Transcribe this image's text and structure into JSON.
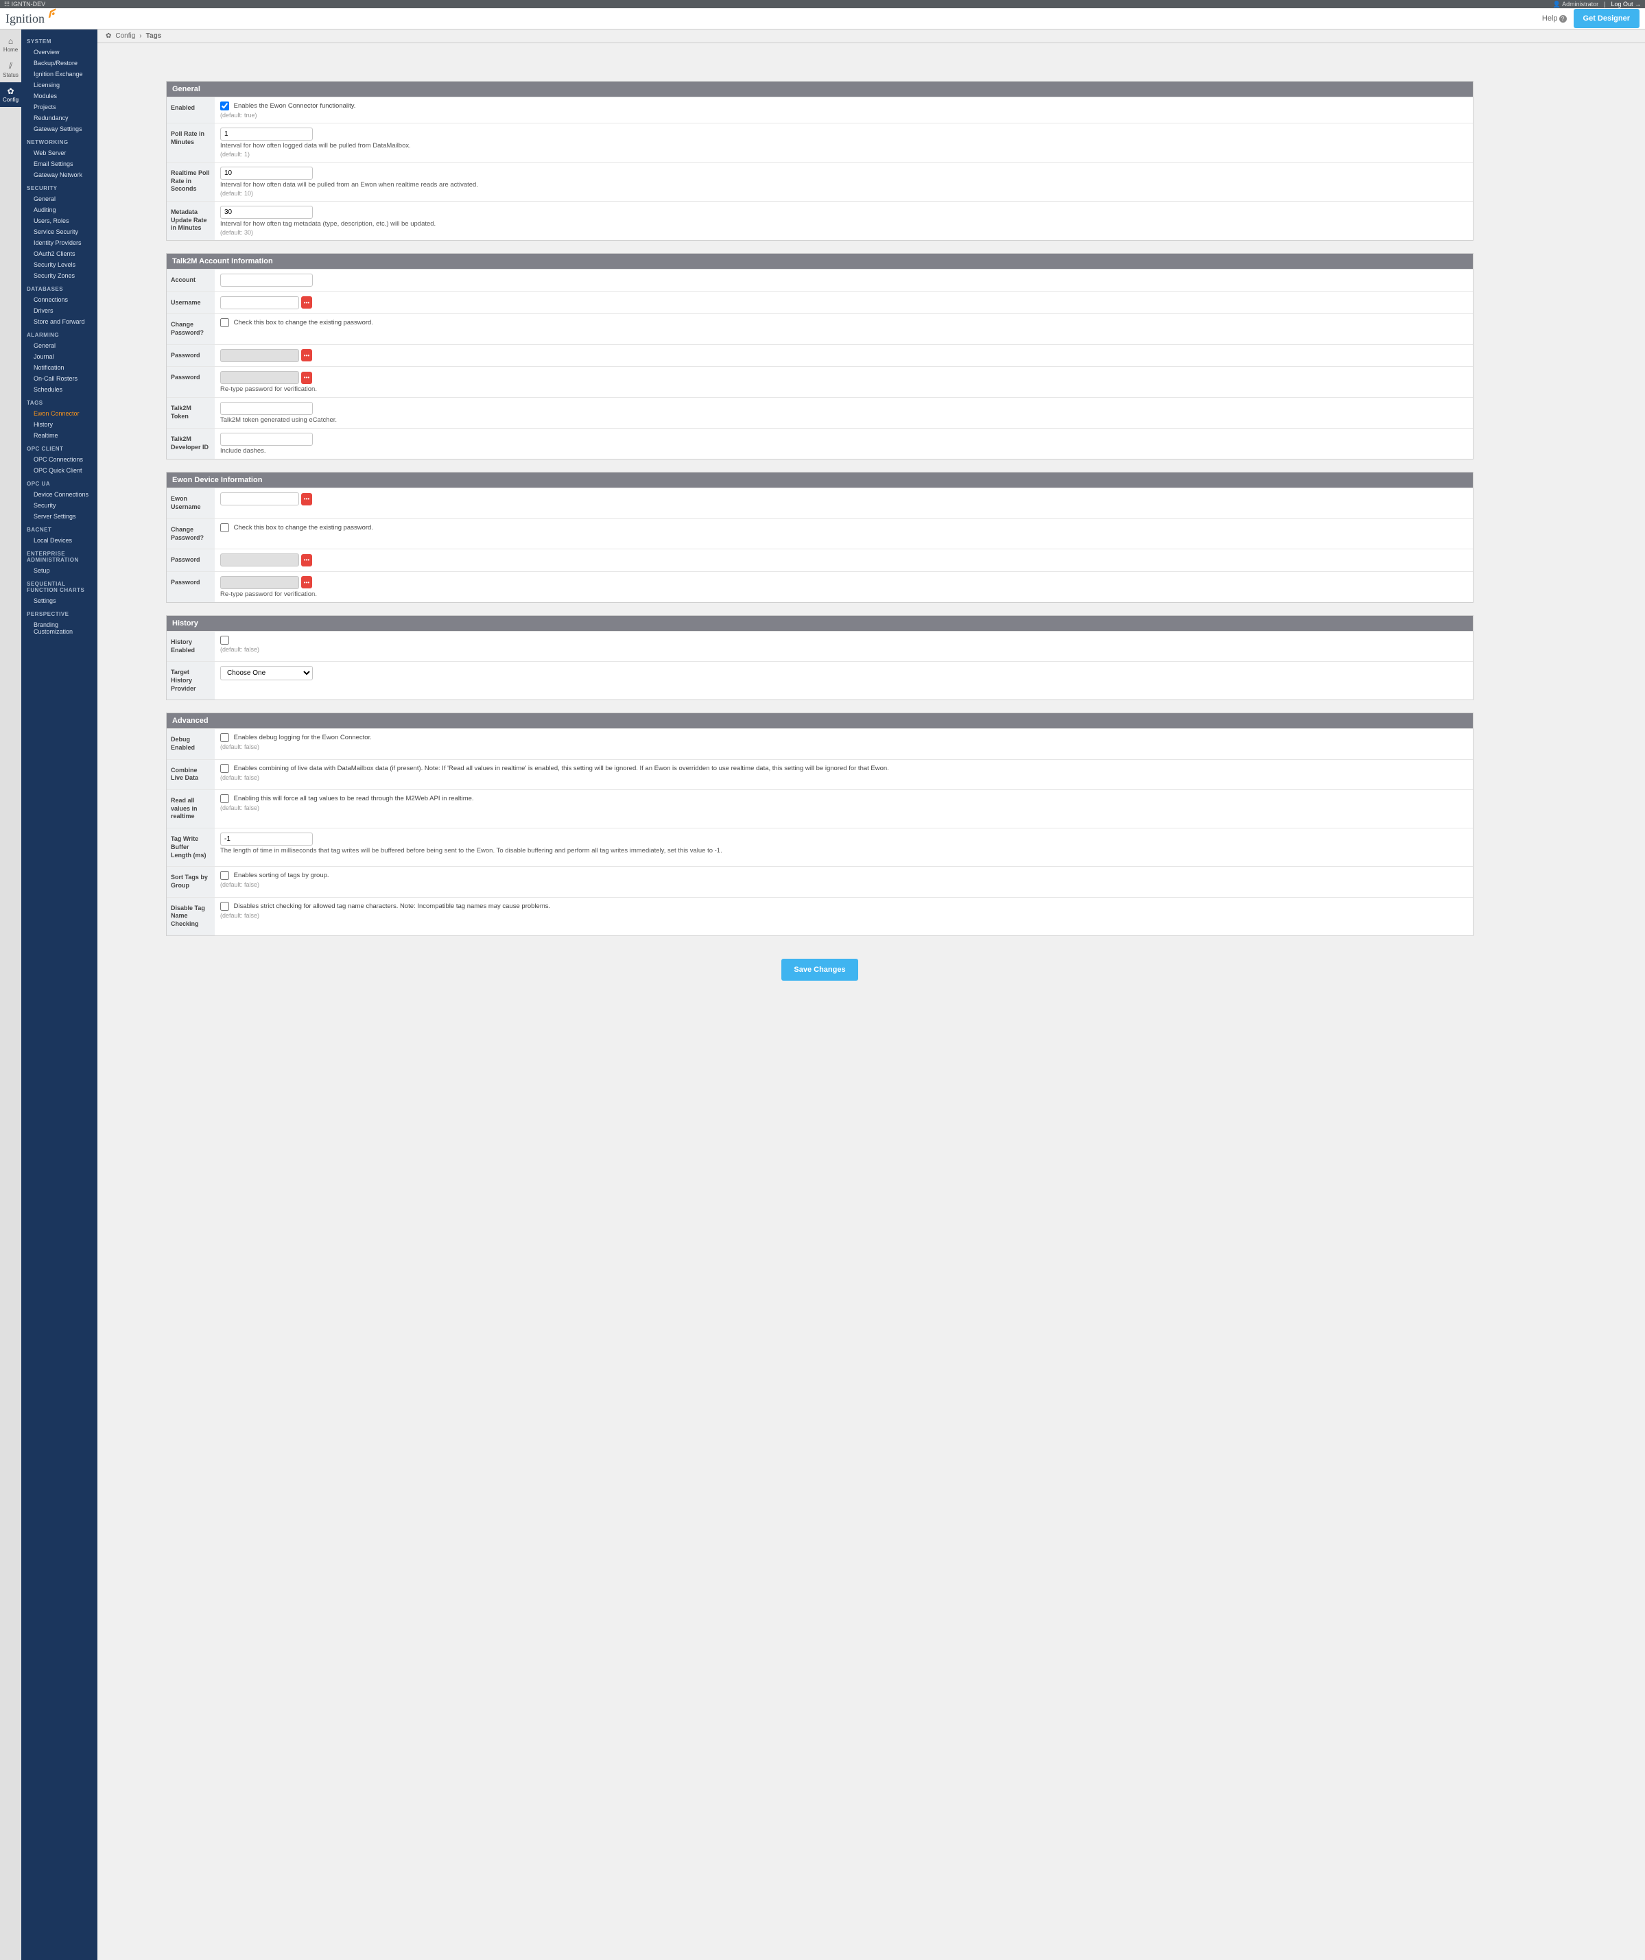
{
  "trialBar": {
    "left": "☷ IGNTN-DEV",
    "admin": "Administrator",
    "logout": "Log Out"
  },
  "header": {
    "logo": "Ignition",
    "help": "Help",
    "designer": "Get Designer"
  },
  "rail": [
    {
      "icon": "⌂",
      "label": "Home"
    },
    {
      "icon": "⫽",
      "label": "Status"
    },
    {
      "icon": "✿",
      "label": "Config",
      "active": true
    }
  ],
  "sidebar": [
    {
      "heading": "SYSTEM",
      "items": [
        "Overview",
        "Backup/Restore",
        "Ignition Exchange",
        "Licensing",
        "Modules",
        "Projects",
        "Redundancy",
        "Gateway Settings"
      ]
    },
    {
      "heading": "NETWORKING",
      "items": [
        "Web Server",
        "Email Settings",
        "Gateway Network"
      ]
    },
    {
      "heading": "SECURITY",
      "items": [
        "General",
        "Auditing",
        "Users, Roles",
        "Service Security",
        "Identity Providers",
        "OAuth2 Clients",
        "Security Levels",
        "Security Zones"
      ]
    },
    {
      "heading": "DATABASES",
      "items": [
        "Connections",
        "Drivers",
        "Store and Forward"
      ]
    },
    {
      "heading": "ALARMING",
      "items": [
        "General",
        "Journal",
        "Notification",
        "On-Call Rosters",
        "Schedules"
      ]
    },
    {
      "heading": "TAGS",
      "items": [
        "Ewon Connector",
        "History",
        "Realtime"
      ],
      "activeIndex": 0
    },
    {
      "heading": "OPC CLIENT",
      "items": [
        "OPC Connections",
        "OPC Quick Client"
      ]
    },
    {
      "heading": "OPC UA",
      "items": [
        "Device Connections",
        "Security",
        "Server Settings"
      ]
    },
    {
      "heading": "BACNET",
      "items": [
        "Local Devices"
      ]
    },
    {
      "heading": "ENTERPRISE ADMINISTRATION",
      "items": [
        "Setup"
      ]
    },
    {
      "heading": "SEQUENTIAL FUNCTION CHARTS",
      "items": [
        "Settings"
      ]
    },
    {
      "heading": "PERSPECTIVE",
      "items": [
        "Branding Customization"
      ]
    }
  ],
  "breadcrumb": {
    "a": "Config",
    "b": "Tags"
  },
  "sections": {
    "general": {
      "title": "General",
      "enabled": {
        "label": "Enabled",
        "text": "Enables the Ewon Connector functionality.",
        "default": "(default: true)",
        "checked": true
      },
      "pollRate": {
        "label": "Poll Rate in Minutes",
        "value": "1",
        "text": "Interval for how often logged data will be pulled from DataMailbox.",
        "default": "(default: 1)"
      },
      "realtimePoll": {
        "label": "Realtime Poll Rate in Seconds",
        "value": "10",
        "text": "Interval for how often data will be pulled from an Ewon when realtime reads are activated.",
        "default": "(default: 10)"
      },
      "metadata": {
        "label": "Metadata Update Rate in Minutes",
        "value": "30",
        "text": "Interval for how often tag metadata (type, description, etc.) will be updated.",
        "default": "(default: 30)"
      }
    },
    "talk2m": {
      "title": "Talk2M Account Information",
      "account": {
        "label": "Account"
      },
      "username": {
        "label": "Username"
      },
      "change": {
        "label": "Change Password?",
        "text": "Check this box to change the existing password."
      },
      "pw1": {
        "label": "Password"
      },
      "pw2": {
        "label": "Password",
        "text": "Re-type password for verification."
      },
      "token": {
        "label": "Talk2M Token",
        "text": "Talk2M token generated using eCatcher."
      },
      "devid": {
        "label": "Talk2M Developer ID",
        "text": "Include dashes."
      }
    },
    "ewon": {
      "title": "Ewon Device Information",
      "username": {
        "label": "Ewon Username"
      },
      "change": {
        "label": "Change Password?",
        "text": "Check this box to change the existing password."
      },
      "pw1": {
        "label": "Password"
      },
      "pw2": {
        "label": "Password",
        "text": "Re-type password for verification."
      }
    },
    "history": {
      "title": "History",
      "enabled": {
        "label": "History Enabled",
        "default": "(default: false)"
      },
      "target": {
        "label": "Target History Provider",
        "option": "Choose One"
      }
    },
    "advanced": {
      "title": "Advanced",
      "debug": {
        "label": "Debug Enabled",
        "text": "Enables debug logging for the Ewon Connector.",
        "default": "(default: false)"
      },
      "combine": {
        "label": "Combine Live Data",
        "text": "Enables combining of live data with DataMailbox data (if present). Note: If 'Read all values in realtime' is enabled, this setting will be ignored. If an Ewon is overridden to use realtime data, this setting will be ignored for that Ewon.",
        "default": "(default: false)"
      },
      "readall": {
        "label": "Read all values in realtime",
        "text": "Enabling this will force all tag values to be read through the M2Web API in realtime.",
        "default": "(default: false)"
      },
      "buffer": {
        "label": "Tag Write Buffer Length (ms)",
        "value": "-1",
        "text": "The length of time in milliseconds that tag writes will be buffered before being sent to the Ewon. To disable buffering and perform all tag writes immediately, set this value to -1."
      },
      "sort": {
        "label": "Sort Tags by Group",
        "text": "Enables sorting of tags by group.",
        "default": "(default: false)"
      },
      "disable": {
        "label": "Disable Tag Name Checking",
        "text": "Disables strict checking for allowed tag name characters. Note: Incompatible tag names may cause problems.",
        "default": "(default: false)"
      }
    }
  },
  "save": "Save Changes"
}
